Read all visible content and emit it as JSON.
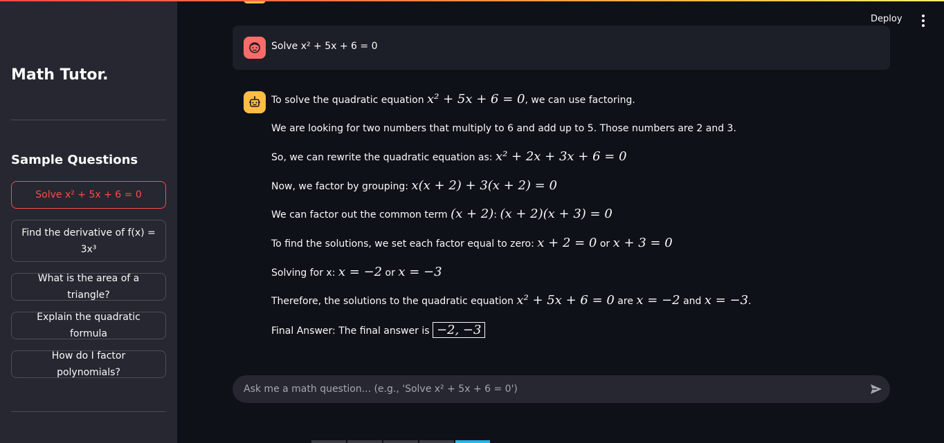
{
  "sidebar": {
    "title": "Math Tutor.",
    "section_title": "Sample Questions",
    "questions": [
      "Solve x² + 5x + 6 = 0",
      "Find the derivative of f(x) = 3x³",
      "What is the area of a triangle?",
      "Explain the quadratic formula",
      "How do I factor polynomials?"
    ],
    "active_index": 0
  },
  "header": {
    "deploy_label": "Deploy",
    "menu_icon": "kebab-menu-icon"
  },
  "chat": {
    "user_message": "Solve x² + 5x + 6 = 0",
    "user_avatar_icon": "user-face-icon",
    "bot_avatar_icon": "robot-icon",
    "assistant": {
      "l1_text": "To solve the quadratic equation ",
      "l1_math": "x² + 5x + 6 = 0",
      "l1_tail": ", we can use factoring.",
      "l2_text": "We are looking for two numbers that multiply to 6 and add up to 5. Those numbers are 2 and 3.",
      "l3_text": "So, we can rewrite the quadratic equation as: ",
      "l3_math": "x² + 2x + 3x + 6 = 0",
      "l4_text": "Now, we factor by grouping: ",
      "l4_math": "x(x + 2) + 3(x + 2) = 0",
      "l5_text": "We can factor out the common term ",
      "l5_math1": "(x + 2)",
      "l5_colon": ": ",
      "l5_math2": "(x + 2)(x + 3) = 0",
      "l6_text": "To find the solutions, we set each factor equal to zero: ",
      "l6_math1": "x + 2 = 0",
      "l6_or": " or ",
      "l6_math2": "x + 3 = 0",
      "l7_text": "Solving for x: ",
      "l7_math1": "x = −2",
      "l7_or": " or ",
      "l7_math2": "x = −3",
      "l8_text": "Therefore, the solutions to the quadratic equation ",
      "l8_math1": "x² + 5x + 6 = 0",
      "l8_are": " are ",
      "l8_math2": "x = −2",
      "l8_and": " and ",
      "l8_math3": "x = −3",
      "l8_dot": ".",
      "l9_text": "Final Answer: The final answer is ",
      "l9_boxed": "−2, −3"
    }
  },
  "input": {
    "placeholder": "Ask me a math question... (e.g., 'Solve x² + 5x + 6 = 0')",
    "send_icon": "send-icon"
  },
  "colors": {
    "accent": "#ff4b4b",
    "sidebar_bg": "#262730",
    "main_bg": "#0e1117",
    "bot_avatar": "#ffbd45",
    "user_avatar": "#ff6b6b"
  }
}
